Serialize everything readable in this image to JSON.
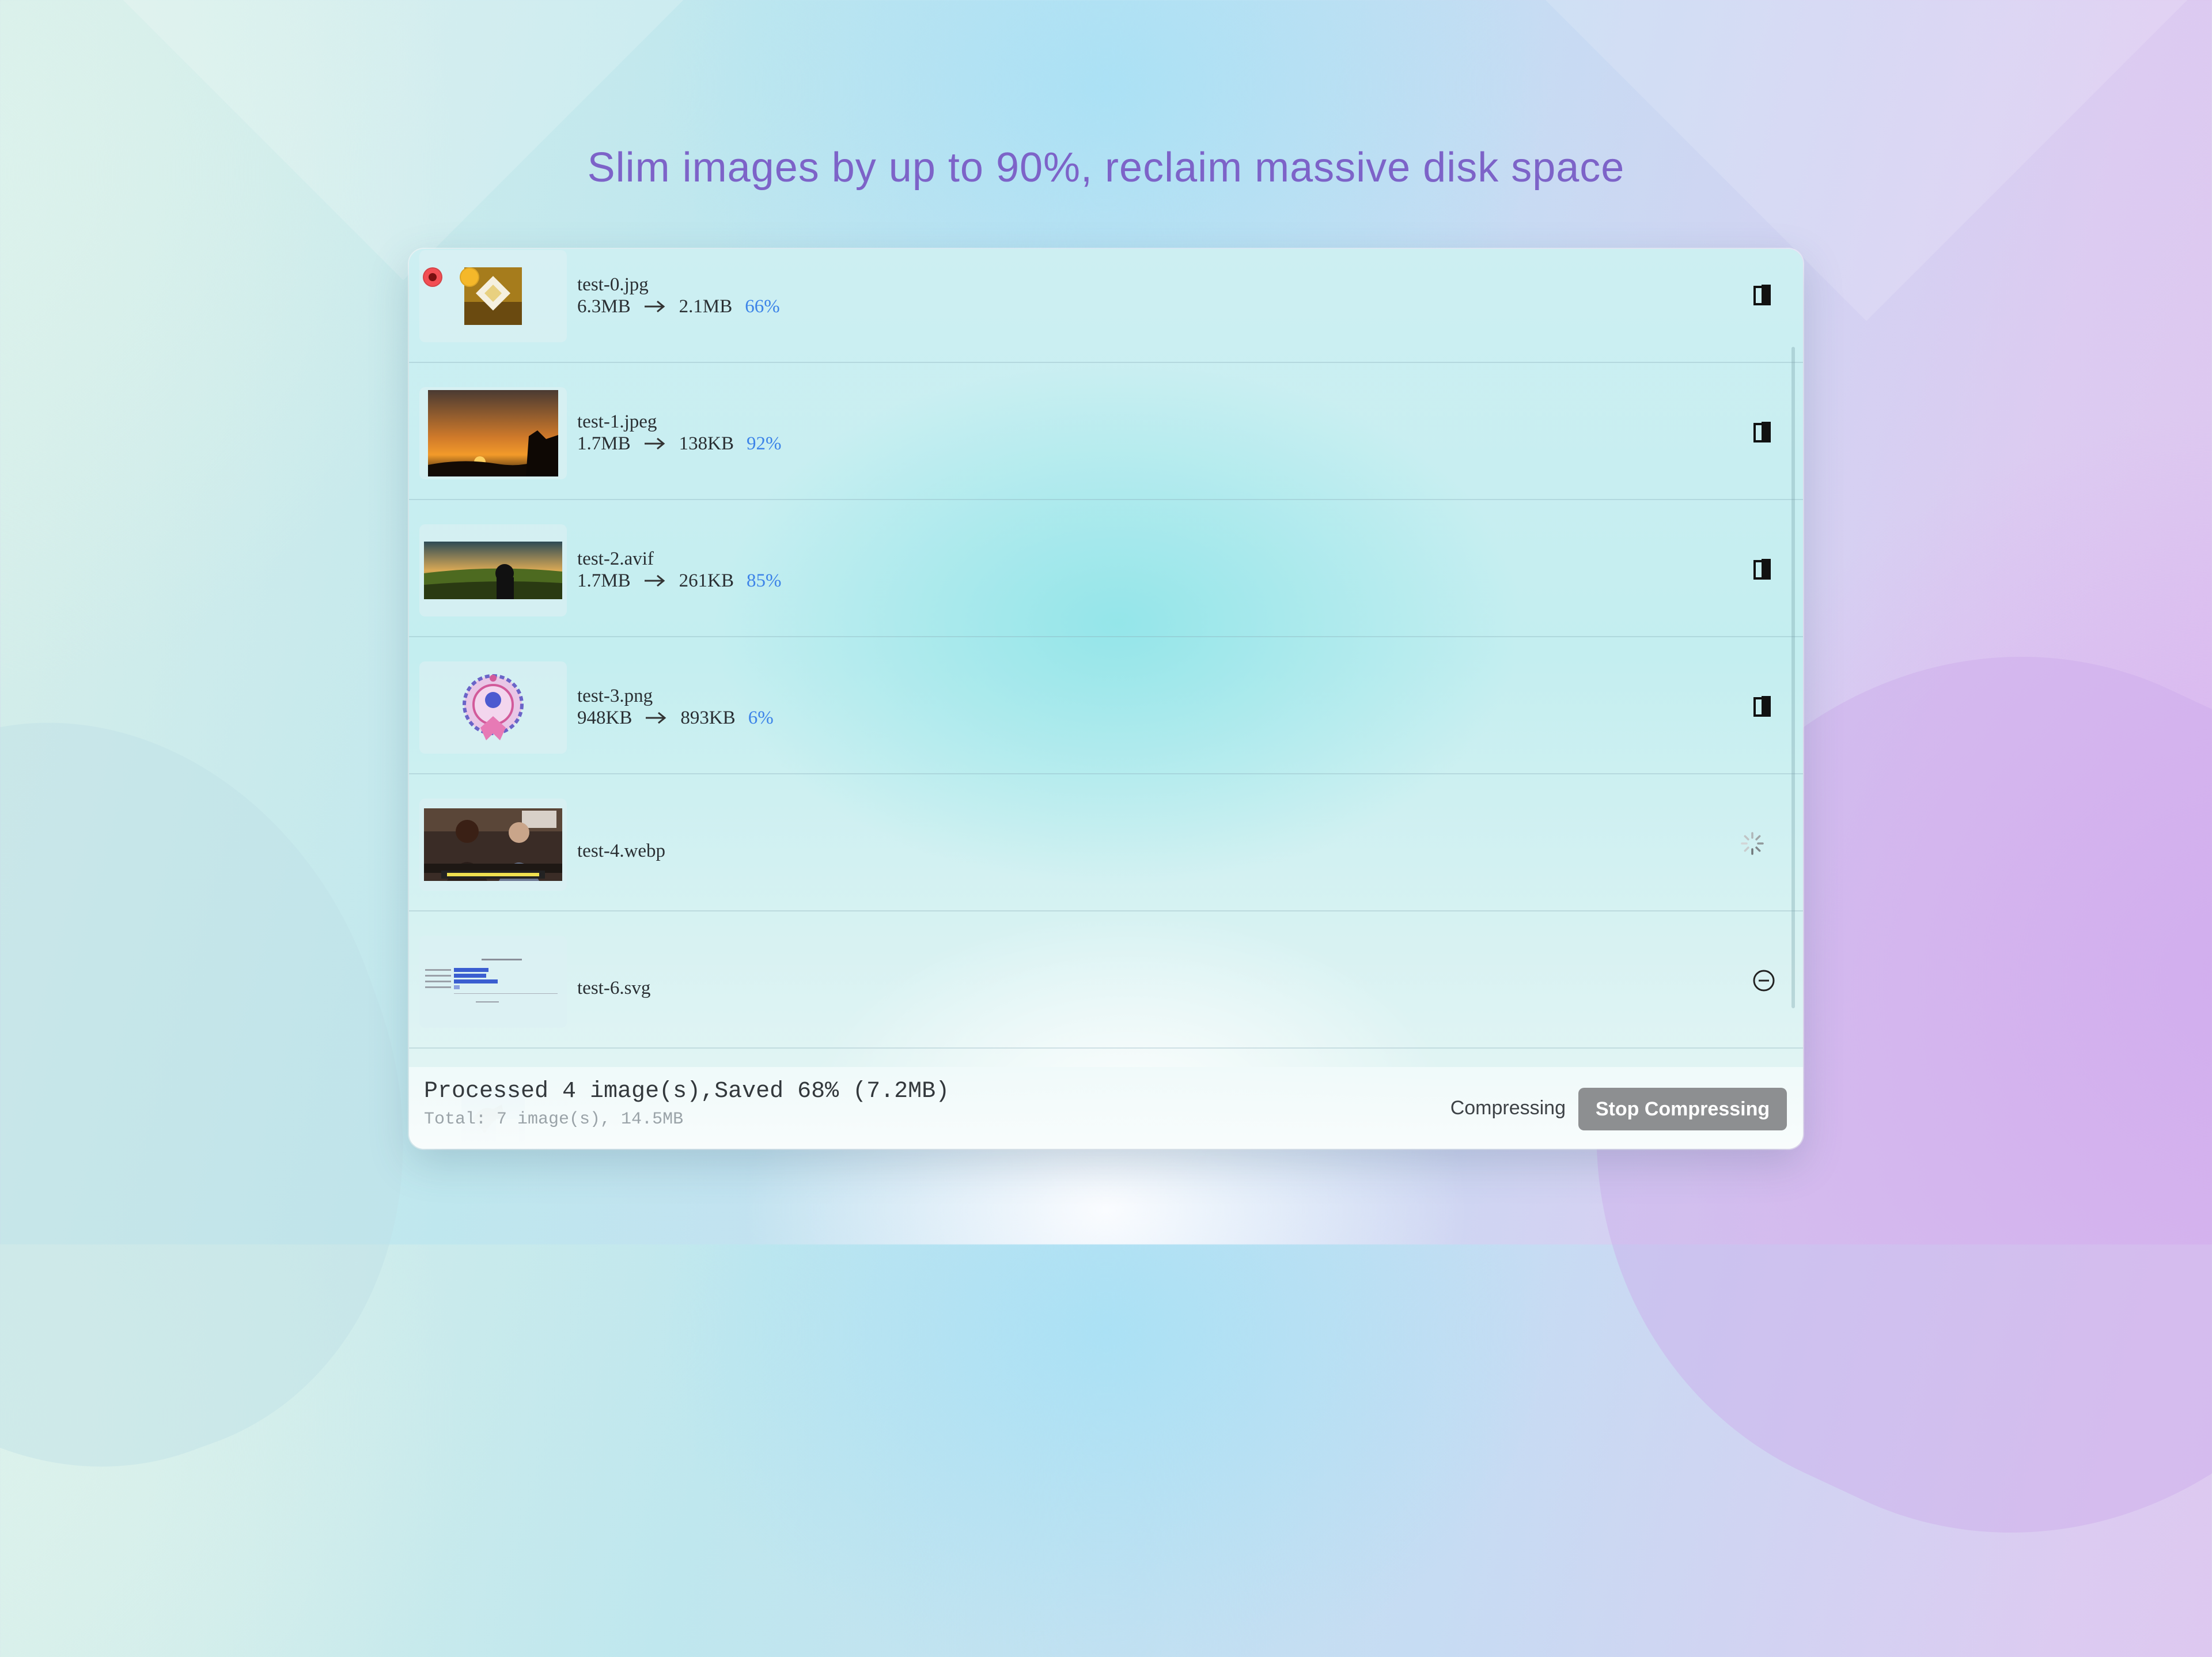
{
  "headline": "Slim images by up to 90%, reclaim massive disk space",
  "window": {
    "controls": [
      "close",
      "minimize"
    ]
  },
  "files": [
    {
      "name": "test-0.jpg",
      "original": "6.3MB",
      "compressed": "2.1MB",
      "saved": "66%",
      "status": "done",
      "icon": "copy-icon"
    },
    {
      "name": "test-1.jpeg",
      "original": "1.7MB",
      "compressed": "138KB",
      "saved": "92%",
      "status": "done",
      "icon": "copy-icon"
    },
    {
      "name": "test-2.avif",
      "original": "1.7MB",
      "compressed": "261KB",
      "saved": "85%",
      "status": "done",
      "icon": "copy-icon"
    },
    {
      "name": "test-3.png",
      "original": "948KB",
      "compressed": "893KB",
      "saved": "6%",
      "status": "done",
      "icon": "copy-icon"
    },
    {
      "name": "test-4.webp",
      "status": "compressing",
      "icon": "spinner-icon"
    },
    {
      "name": "test-6.svg",
      "status": "skipped",
      "icon": "minus-circle-icon"
    },
    {
      "status": "pending"
    }
  ],
  "footer": {
    "summary": "Processed 4 image(s),Saved 68% (7.2MB)",
    "total": "Total: 7 image(s), 14.5MB",
    "status": "Compressing",
    "stop_label": "Stop Compressing"
  },
  "colors": {
    "accent_percent": "#3d84e8",
    "headline": "#7d63c8",
    "close": "#f24e53",
    "minimize": "#f5b82a",
    "stop_button": "#8d8f91"
  }
}
